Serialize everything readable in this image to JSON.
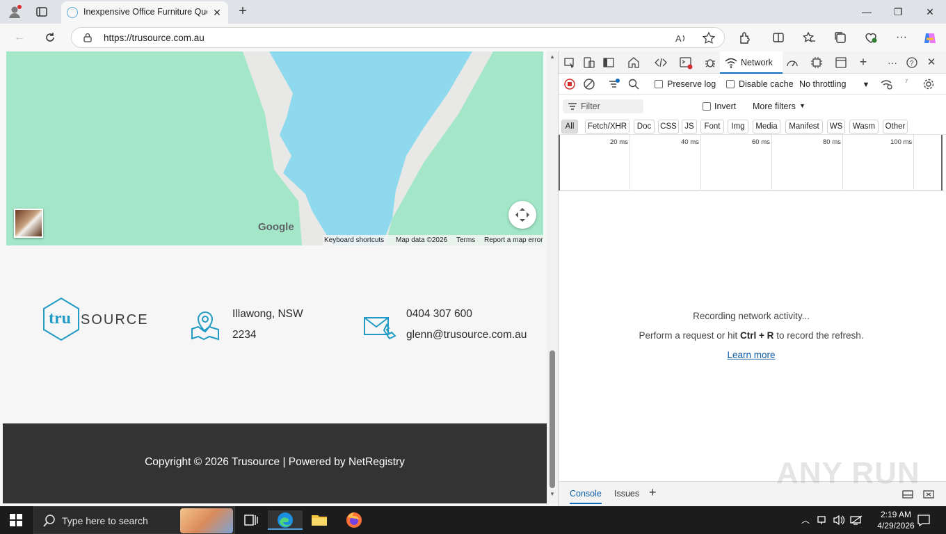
{
  "browser": {
    "tab_title": "Inexpensive Office Furniture Quot",
    "url": "https://trusource.com.au"
  },
  "map": {
    "google_logo": "Google",
    "footer": {
      "keyboard_shortcuts": "Keyboard shortcuts",
      "map_data": "Map data ©2026",
      "terms": "Terms",
      "report": "Report a map error"
    }
  },
  "site_footer": {
    "logo_tru": "tru",
    "logo_source": "SOURCE",
    "location_line1": "Illawong, NSW",
    "location_line2": "2234",
    "phone": "0404 307 600",
    "email": "glenn@trusource.com.au",
    "copyright": "Copyright © 2026 Trusource | Powered by NetRegistry"
  },
  "devtools": {
    "network_tab": "Network",
    "preserve_log": "Preserve log",
    "disable_cache": "Disable cache",
    "throttling": "No throttling",
    "filter_placeholder": "Filter",
    "invert": "Invert",
    "more_filters": "More filters",
    "types": [
      "All",
      "Fetch/XHR",
      "Doc",
      "CSS",
      "JS",
      "Font",
      "Img",
      "Media",
      "Manifest",
      "WS",
      "Wasm",
      "Other"
    ],
    "timeline_labels": [
      "20 ms",
      "40 ms",
      "60 ms",
      "80 ms",
      "100 ms"
    ],
    "recording": "Recording network activity...",
    "hint_prefix": "Perform a request or hit ",
    "hint_keys": "Ctrl + R",
    "hint_suffix": " to record the refresh.",
    "learn_more": "Learn more",
    "drawer_console": "Console",
    "drawer_issues": "Issues"
  },
  "watermark": "ANY RUN",
  "taskbar": {
    "search_placeholder": "Type here to search",
    "time": "2:19 AM",
    "date": "4/29/2026"
  },
  "colors": {
    "brand_blue": "#1f9bc4",
    "map_water": "#8fd9ee",
    "map_land": "#a3e7c8",
    "footer_dark": "#333333",
    "devtools_accent": "#0f6cbd"
  }
}
